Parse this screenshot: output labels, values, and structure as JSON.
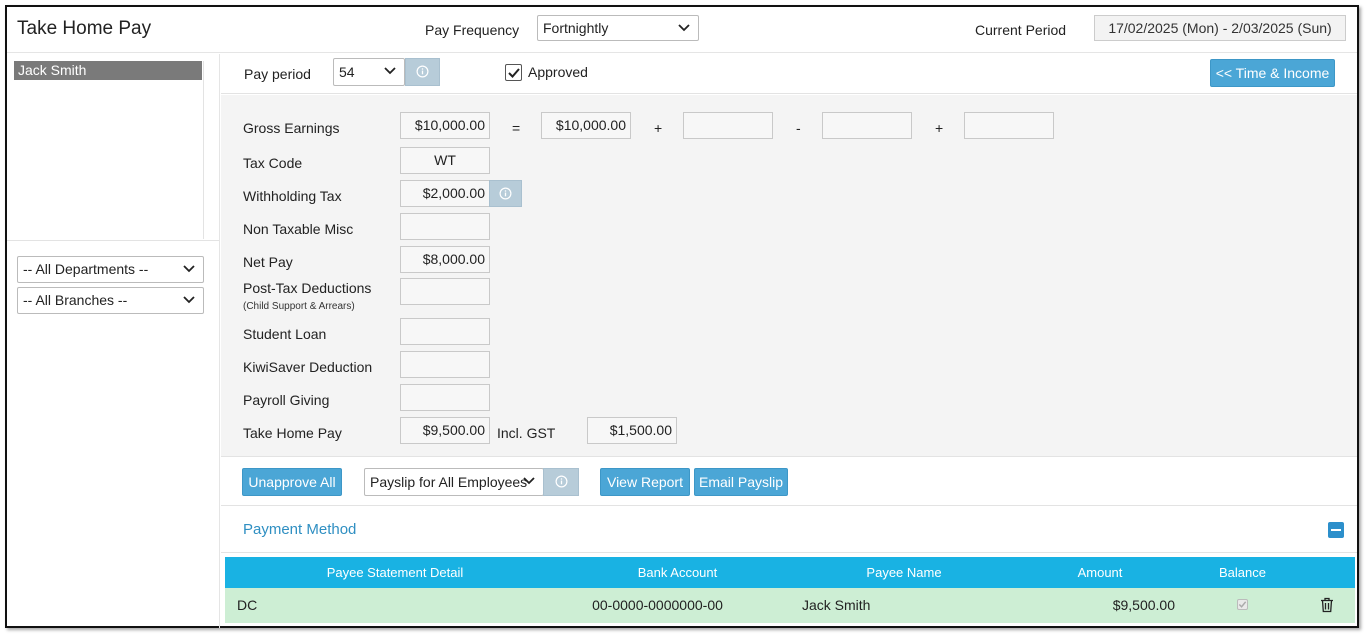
{
  "header": {
    "title": "Take Home Pay",
    "pay_frequency_label": "Pay Frequency",
    "pay_frequency_value": "Fortnightly",
    "current_period_label": "Current Period",
    "current_period_value": "17/02/2025 (Mon) - 2/03/2025 (Sun)"
  },
  "sidebar": {
    "employees": [
      "Jack Smith"
    ],
    "department_filter": "-- All Departments --",
    "branch_filter": "-- All Branches --"
  },
  "topbar": {
    "pay_period_label": "Pay period",
    "pay_period_value": "54",
    "approved_label": "Approved",
    "approved_checked": true,
    "time_income_button": "<< Time & Income"
  },
  "form": {
    "gross_earnings_label": "Gross Earnings",
    "gross_earnings_value": "$10,000.00",
    "equals": "=",
    "gross_part1": "$10,000.00",
    "plus1": "+",
    "gross_part2": "",
    "minus": "-",
    "gross_part3": "",
    "plus2": "+",
    "gross_part4": "",
    "tax_code_label": "Tax Code",
    "tax_code_value": "WT",
    "withholding_tax_label": "Withholding Tax",
    "withholding_tax_value": "$2,000.00",
    "non_taxable_misc_label": "Non Taxable Misc",
    "non_taxable_misc_value": "",
    "net_pay_label": "Net Pay",
    "net_pay_value": "$8,000.00",
    "post_tax_deductions_label": "Post-Tax Deductions",
    "post_tax_deductions_sub": "(Child Support & Arrears)",
    "post_tax_deductions_value": "",
    "student_loan_label": "Student Loan",
    "student_loan_value": "",
    "kiwisaver_label": "KiwiSaver Deduction",
    "kiwisaver_value": "",
    "payroll_giving_label": "Payroll Giving",
    "payroll_giving_value": "",
    "take_home_pay_label": "Take Home Pay",
    "take_home_pay_value": "$9,500.00",
    "incl_gst_label": "Incl. GST",
    "incl_gst_value": "$1,500.00"
  },
  "actions": {
    "unapprove_all": "Unapprove All",
    "payslip_select": "Payslip for All Employees",
    "view_report": "View Report",
    "email_payslip": "Email Payslip"
  },
  "payment": {
    "title": "Payment Method",
    "columns": [
      "Payee Statement Detail",
      "Bank Account",
      "Payee Name",
      "Amount",
      "Balance"
    ],
    "rows": [
      {
        "detail": "DC",
        "bank_account": "00-0000-0000000-00",
        "payee_name": "Jack Smith",
        "amount": "$9,500.00",
        "balance_checked": true
      }
    ]
  },
  "colors": {
    "accent_button": "#4ba6d6",
    "table_header": "#19b2e3",
    "row_highlight": "#cdeed4",
    "selected_employee": "#7a7a7a"
  }
}
